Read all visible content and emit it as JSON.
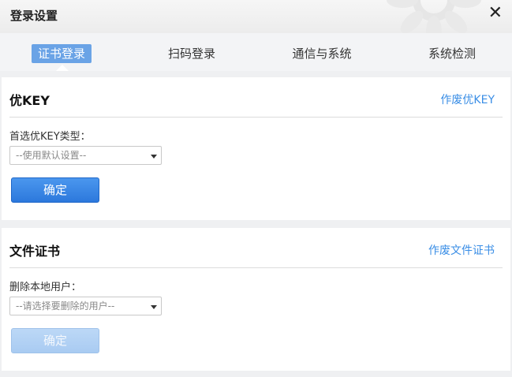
{
  "window": {
    "title": "登录设置",
    "close_icon": "close-icon"
  },
  "tabs": [
    {
      "label": "证书登录",
      "active": true
    },
    {
      "label": "扫码登录",
      "active": false
    },
    {
      "label": "通信与系统",
      "active": false
    },
    {
      "label": "系统检测",
      "active": false
    }
  ],
  "ukey": {
    "title": "优KEY",
    "revoke_link": "作废优KEY",
    "field_label": "首选优KEY类型：",
    "select_value": "--使用默认设置--",
    "confirm_label": "确定"
  },
  "file_cert": {
    "title": "文件证书",
    "revoke_link": "作废文件证书",
    "field_label": "删除本地用户：",
    "select_value": "--请选择要删除的用户--",
    "confirm_label": "确定"
  },
  "colors": {
    "accent": "#3a8ee6",
    "tab_active_bg": "#6aa3e6",
    "button_primary": "#2c78dc",
    "button_disabled": "#a9cbf2"
  }
}
